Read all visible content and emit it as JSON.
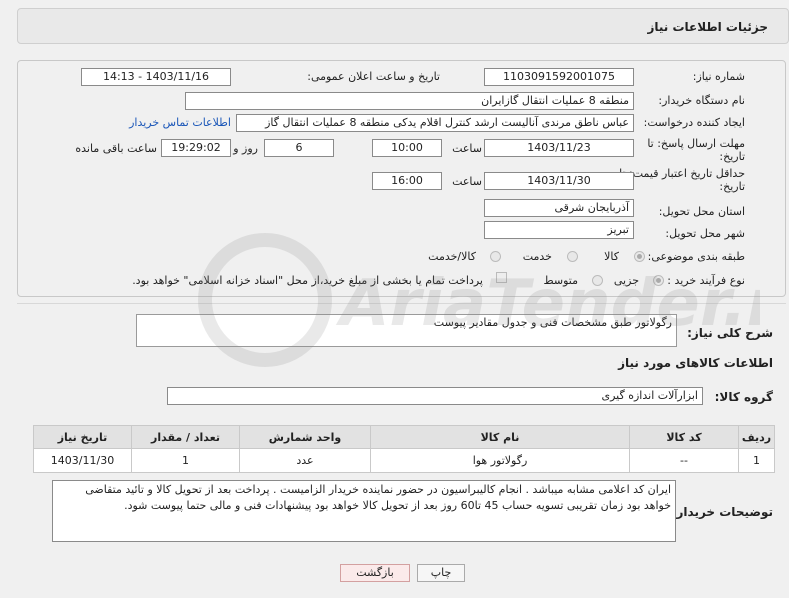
{
  "header": {
    "title": "جزئیات اطلاعات نیاز"
  },
  "need_number": {
    "label": "شماره نیاز:",
    "value": "1103091592001075"
  },
  "announce_datetime": {
    "label": "تاریخ و ساعت اعلان عمومی:",
    "value": "1403/11/16 - 14:13"
  },
  "buyer_org": {
    "label": "نام دستگاه خریدار:",
    "value": "منطقه 8 عملیات انتقال گازایران"
  },
  "requester": {
    "label": "ایجاد کننده درخواست:",
    "value": "عباس ناطق مرندی آنالیست ارشد کنترل اقلام یدکی منطقه 8 عملیات انتقال گاز",
    "contact_link": "اطلاعات تماس خریدار"
  },
  "reply_deadline": {
    "label_line1": "مهلت ارسال پاسخ: تا",
    "label_line2": "تاریخ:",
    "date": "1403/11/23",
    "time_label": "ساعت",
    "time": "10:00",
    "days": "6",
    "days_label": "روز و",
    "remaining": "19:29:02",
    "remaining_label": "ساعت باقی مانده"
  },
  "price_validity": {
    "label_line1": "حداقل تاریخ اعتبار قیمت: تا",
    "label_line2": "تاریخ:",
    "date": "1403/11/30",
    "time_label": "ساعت",
    "time": "16:00"
  },
  "province": {
    "label": "استان محل تحویل:",
    "value": "آذربایجان شرقی"
  },
  "city": {
    "label": "شهر محل تحویل:",
    "value": "تبریز"
  },
  "category": {
    "label": "طبقه بندی موضوعی:",
    "options": [
      "کالا",
      "خدمت",
      "کالا/خدمت"
    ],
    "selected": "کالا"
  },
  "purchase_process": {
    "label": "نوع فرآیند خرید :",
    "options": [
      "جزیی",
      "متوسط"
    ],
    "selected": "جزیی",
    "payment_note": "پرداخت تمام یا بخشی از مبلغ خرید،از محل \"اسناد خزانه اسلامی\" خواهد بود."
  },
  "summary": {
    "label": "شرح کلی نیاز:",
    "value": "رگولاتور طبق مشخصات فنی و جدول مقادیر پیوست"
  },
  "goods_section": {
    "title": "اطلاعات کالاهای مورد نیاز"
  },
  "goods_group": {
    "label": "گروه کالا:",
    "value": "ابزارآلات اندازه گیری"
  },
  "table": {
    "headers": [
      "ردیف",
      "کد کالا",
      "نام کالا",
      "واحد شمارش",
      "تعداد / مقدار",
      "تاریخ نیاز"
    ],
    "rows": [
      [
        "1",
        "--",
        "رگولاتور هوا",
        "عدد",
        "1",
        "1403/11/30"
      ]
    ]
  },
  "buyer_notes": {
    "label": "توضیحات خریدار:",
    "value": "ایران کد اعلامی مشابه میباشد . انجام کالیبراسیون در حضور نماینده خریدار الزامیست . پرداخت  بعد از تحویل کالا و تائید متقاضی خواهد بود زمان  تقریبی تسویه حساب 45 تا60 روز بعد از تحویل کالا خواهد بود پیشنهادات فنی و مالی حتما پیوست شود."
  },
  "buttons": {
    "print": "چاپ",
    "back": "بازگشت"
  },
  "watermark": {
    "text": "AriaTender.net"
  }
}
